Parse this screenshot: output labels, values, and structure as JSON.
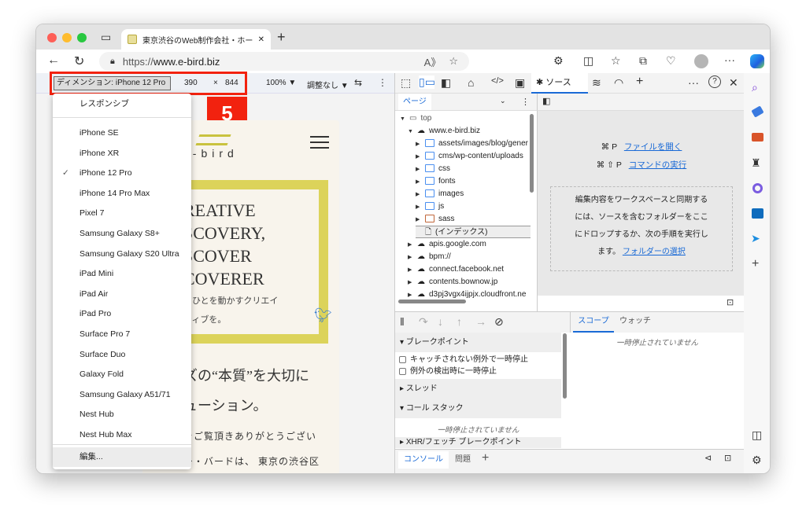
{
  "browser": {
    "tab_title": "東京渋谷のWeb制作会社・ホーム",
    "url_prefix": "https://",
    "url_host": "www.e-bird.biz"
  },
  "device_toolbar": {
    "dimension_label": "ディメンション: iPhone 12 Pro",
    "width": "390",
    "times": "×",
    "height": "844",
    "zoom": "100%",
    "throttle": "調整なし"
  },
  "step_badge": "5",
  "device_menu": {
    "responsive": "レスポンシブ",
    "items": [
      "iPhone SE",
      "iPhone XR",
      "iPhone 12 Pro",
      "iPhone 14 Pro Max",
      "Pixel 7",
      "Samsung Galaxy S8+",
      "Samsung Galaxy S20 Ultra",
      "iPad Mini",
      "iPad Air",
      "iPad Pro",
      "Surface Pro 7",
      "Surface Duo",
      "Galaxy Fold",
      "Samsung Galaxy A51/71",
      "Nest Hub",
      "Nest Hub Max"
    ],
    "selected": "iPhone 12 Pro",
    "edit": "編集..."
  },
  "site": {
    "logo": "e-bird",
    "hero_lines": [
      "REATIVE",
      "SCOVERY,",
      "SCOVER",
      "COVERER"
    ],
    "hero_sub1": "、ひとを動かすクリエイ",
    "hero_sub2": "ティブを。",
    "headline1": "ズの“本質”を大切に",
    "headline2": "ューション。",
    "body1": "をご覧頂きありがとうござい",
    "body2": "ー・バードは、 東京の渋谷区",
    "accent": "#dcd35a"
  },
  "devtools": {
    "sources_tab": "ソース",
    "page_tab": "ページ",
    "tree": {
      "top": "top",
      "host": "www.e-bird.biz",
      "folders": [
        "assets/images/blog/gener",
        "cms/wp-content/uploads",
        "css",
        "fonts",
        "images",
        "js",
        "sass"
      ],
      "index": "(インデックス)",
      "others": [
        "apis.google.com",
        "bpm://",
        "connect.facebook.net",
        "contents.bownow.jp",
        "d3pj3vgx4ijpjx.cloudfront.ne"
      ]
    },
    "shortcut1_keys": "⌘ P",
    "shortcut1_label": "ファイルを開く",
    "shortcut2_keys": "⌘ ⇧ P",
    "shortcut2_label": "コマンドの実行",
    "drop_lines": [
      "編集内容をワークスペースと同期する",
      "には、ソースを含むフォルダーをここ",
      "にドロップするか、次の手順を実行し"
    ],
    "drop_last": "ます。",
    "drop_link": "フォルダーの選択",
    "breakpoints": "ブレークポイント",
    "uncaught": "キャッチされない例外で一時停止",
    "caught": "例外の検出時に一時停止",
    "threads": "スレッド",
    "callstack": "コール スタック",
    "not_paused": "一時停止されていません",
    "xhr": "XHR/フェッチ ブレークポイント",
    "scope": "スコープ",
    "watch": "ウォッチ",
    "console": "コンソール",
    "issues": "問題",
    "accent": "#1a6ad6"
  }
}
